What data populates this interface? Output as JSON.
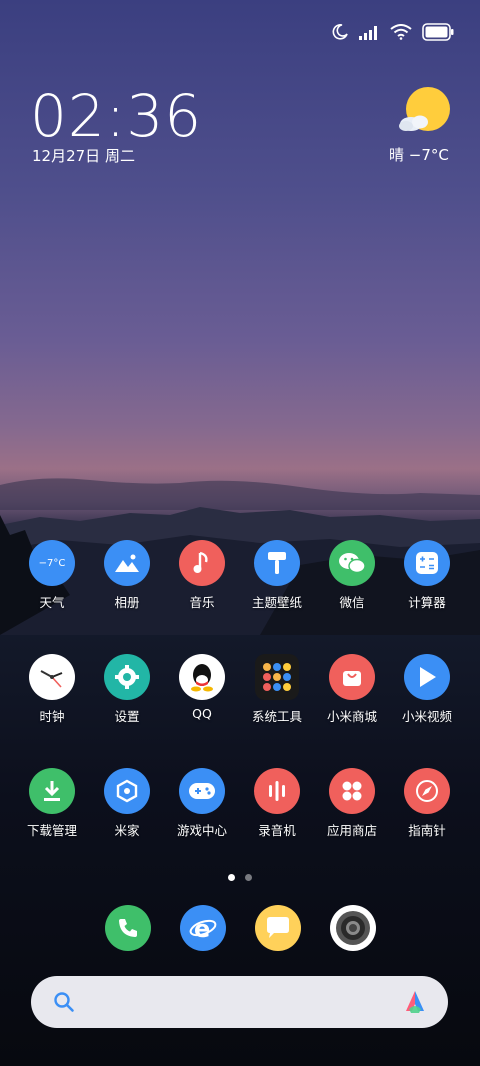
{
  "status": {
    "icons": [
      "moon-icon",
      "signal-icon",
      "wifi-icon",
      "battery-icon"
    ]
  },
  "clock": {
    "time": "02:36",
    "date": "12月27日 周二"
  },
  "weather": {
    "condition_icon": "sunny-cloud-icon",
    "text": "晴  −7°C",
    "widget_temp": "−7°C"
  },
  "apps": [
    {
      "label": "天气",
      "icon": "weather-icon",
      "color": "#3b8ff5"
    },
    {
      "label": "相册",
      "icon": "gallery-icon",
      "color": "#3b8ff5"
    },
    {
      "label": "音乐",
      "icon": "music-icon",
      "color": "#f0605c"
    },
    {
      "label": "主题壁纸",
      "icon": "themes-icon",
      "color": "#3b8ff5"
    },
    {
      "label": "微信",
      "icon": "wechat-icon",
      "color": "#3fbf6a"
    },
    {
      "label": "计算器",
      "icon": "calculator-icon",
      "color": "#3b8ff5"
    },
    {
      "label": "时钟",
      "icon": "clock-icon",
      "color": "#ffffff"
    },
    {
      "label": "设置",
      "icon": "settings-icon",
      "color": "#22b6a6"
    },
    {
      "label": "QQ",
      "icon": "qq-icon",
      "color": "#ffffff"
    },
    {
      "label": "系统工具",
      "icon": "folder-icon",
      "color": "#1a1a1a"
    },
    {
      "label": "小米商城",
      "icon": "mi-store-icon",
      "color": "#f0605c"
    },
    {
      "label": "小米视频",
      "icon": "mi-video-icon",
      "color": "#3b8ff5"
    },
    {
      "label": "下载管理",
      "icon": "download-icon",
      "color": "#3fbf6a"
    },
    {
      "label": "米家",
      "icon": "mijia-icon",
      "color": "#3b8ff5"
    },
    {
      "label": "游戏中心",
      "icon": "game-icon",
      "color": "#3b8ff5"
    },
    {
      "label": "录音机",
      "icon": "recorder-icon",
      "color": "#f0605c"
    },
    {
      "label": "应用商店",
      "icon": "app-store-icon",
      "color": "#f0605c"
    },
    {
      "label": "指南针",
      "icon": "compass-icon",
      "color": "#f0605c"
    }
  ],
  "dock": [
    {
      "icon": "phone-icon",
      "color": "#3fbf6a"
    },
    {
      "icon": "browser-icon",
      "color": "#3b8ff5"
    },
    {
      "icon": "messages-icon",
      "color": "#ffd15a"
    },
    {
      "icon": "camera-icon",
      "color": "#ffffff"
    }
  ],
  "pager": {
    "pages": 2,
    "current": 1
  },
  "search": {
    "icon": "search-icon",
    "assistant_icon": "assistant-icon"
  }
}
